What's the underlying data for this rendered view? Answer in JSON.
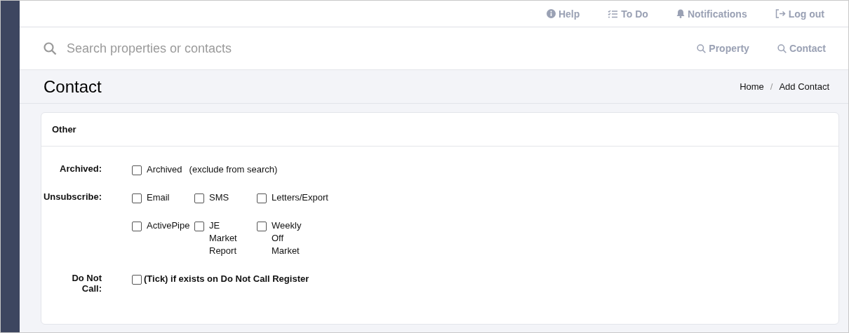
{
  "top_nav": [
    {
      "kind": "help",
      "label": "Help"
    },
    {
      "kind": "todo",
      "label": "To Do"
    },
    {
      "kind": "bell",
      "label": "Notifications"
    },
    {
      "kind": "logout",
      "label": "Log out"
    }
  ],
  "search": {
    "placeholder": "Search properties or contacts"
  },
  "search_links": [
    "Property",
    "Contact"
  ],
  "page_title": "Contact",
  "breadcrumb": {
    "items": [
      "Home",
      "Add Contact"
    ],
    "separator": "/"
  },
  "card": {
    "title": "Other",
    "fields": [
      {
        "label": "Archived:",
        "kind": "plain",
        "options": [
          {
            "label": "Archived",
            "checked": false
          }
        ],
        "note": "(exclude from search)"
      },
      {
        "label": "Unsubscribe:",
        "kind": "plain",
        "options": [
          {
            "label": "Email",
            "checked": false
          },
          {
            "label": "SMS",
            "checked": false
          },
          {
            "label": "Letters/Export",
            "checked": false
          },
          {
            "label": "ActivePipe",
            "checked": false
          },
          {
            "label": "JE Market Report",
            "checked": false
          },
          {
            "label": "Weekly Off Market",
            "checked": false
          }
        ]
      },
      {
        "label": "Do Not Call:",
        "kind": "strong",
        "options": [
          {
            "label": "(Tick) if exists on Do Not Call Register",
            "checked": false
          }
        ]
      }
    ]
  }
}
